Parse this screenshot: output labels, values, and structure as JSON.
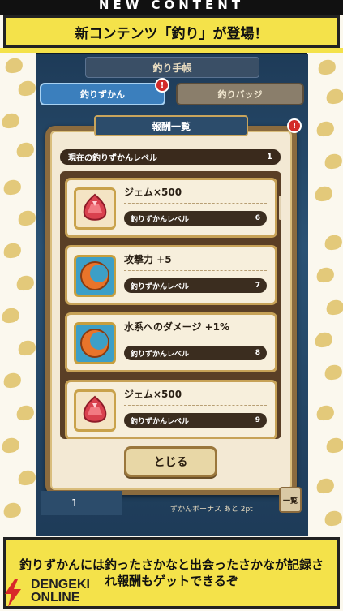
{
  "banner": {
    "top_label": "NEW CONTENT",
    "title": "新コンテンツ「釣り」が登場！"
  },
  "game": {
    "notebook_title": "釣り手帳",
    "tabs": [
      {
        "label": "釣りずかん"
      },
      {
        "label": "釣りバッジ"
      }
    ],
    "badge": "!",
    "dialog": {
      "header": "報酬一覧",
      "current_level_label": "現在の釣りずかんレベル",
      "current_level_value": "1",
      "rewards": [
        {
          "name": "ジェム×500",
          "req_label": "釣りずかんレベル",
          "req_level": "6",
          "icon": "red-gem-icon"
        },
        {
          "name": "攻撃力 +5",
          "req_label": "釣りずかんレベル",
          "req_level": "7",
          "icon": "orange-crescent-icon"
        },
        {
          "name": "水系へのダメージ +1%",
          "req_label": "釣りずかんレベル",
          "req_level": "8",
          "icon": "orange-crescent-icon"
        },
        {
          "name": "ジェム×500",
          "req_label": "釣りずかんレベル",
          "req_level": "9",
          "icon": "red-gem-icon"
        }
      ],
      "close_label": "とじる"
    },
    "bottom": {
      "count": "1",
      "bonus_text": "ずかんボーナス あと 2pt",
      "side_button": "一覧"
    }
  },
  "caption": {
    "text": "釣りずかんには釣ったさかなと出会ったさかなが記録され報酬もゲットできるぞ"
  },
  "logo": {
    "line1": "DENGEKI",
    "line2": "ONLINE"
  }
}
